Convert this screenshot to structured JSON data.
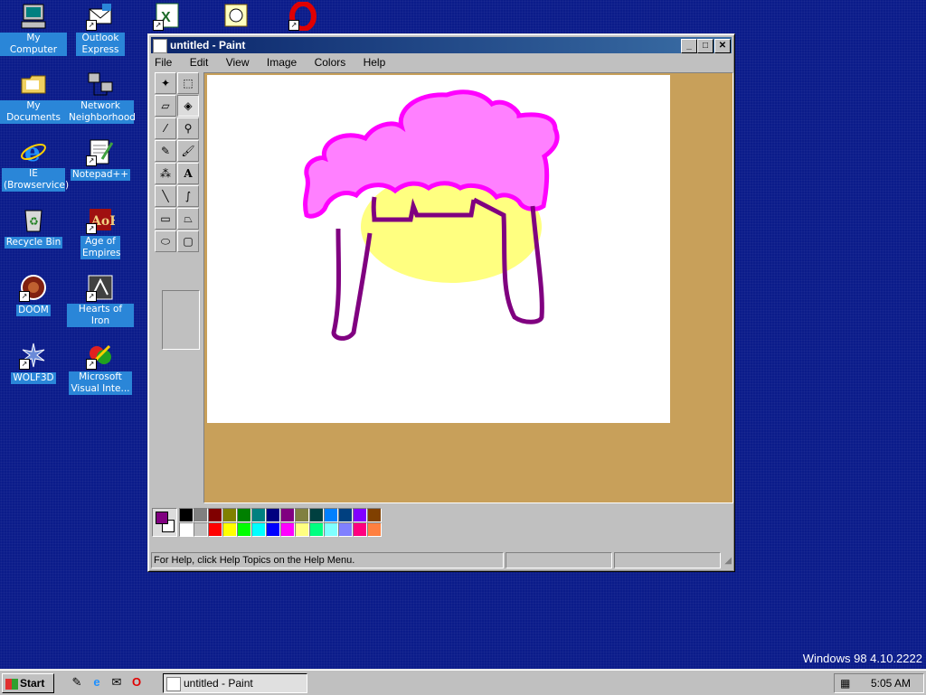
{
  "desktop": {
    "icons": [
      {
        "label": "My Computer"
      },
      {
        "label": "Outlook Express"
      },
      {
        "label": ""
      },
      {
        "label": ""
      },
      {
        "label": ""
      },
      {
        "label": "My Documents"
      },
      {
        "label": "Network Neighborhood"
      },
      {
        "label": "IE (Browservice)"
      },
      {
        "label": "Notepad++"
      },
      {
        "label": "Recycle Bin"
      },
      {
        "label": "Age of Empires"
      },
      {
        "label": "DOOM"
      },
      {
        "label": "Hearts of Iron"
      },
      {
        "label": "WOLF3D"
      },
      {
        "label": "Microsoft Visual Inte..."
      }
    ],
    "version_text": "Windows 98 4.10.2222"
  },
  "window": {
    "title": "untitled - Paint",
    "menu": [
      "File",
      "Edit",
      "View",
      "Image",
      "Colors",
      "Help"
    ],
    "tools": [
      "free-select",
      "rect-select",
      "eraser",
      "fill",
      "color-picker",
      "magnifier",
      "pencil",
      "brush",
      "airbrush",
      "text",
      "line",
      "curve",
      "rectangle",
      "polygon",
      "ellipse",
      "rounded-rect"
    ],
    "selected_tool": "fill",
    "status_text": "For Help, click Help Topics on the Help Menu.",
    "foreground_color": "#800080",
    "background_color": "#ffffff",
    "palette": [
      "#000000",
      "#808080",
      "#800000",
      "#808000",
      "#008000",
      "#008080",
      "#000080",
      "#800080",
      "#808040",
      "#004040",
      "#0080ff",
      "#004080",
      "#8000ff",
      "#804000",
      "#ffffff",
      "#c0c0c0",
      "#ff0000",
      "#ffff00",
      "#00ff00",
      "#00ffff",
      "#0000ff",
      "#ff00ff",
      "#ffff80",
      "#00ff80",
      "#80ffff",
      "#8080ff",
      "#ff0080",
      "#ff8040"
    ],
    "drawing_colors": {
      "hair": "#ff80ff",
      "hair_outline": "#ff00ff",
      "face": "#ffff80",
      "lines": "#800080"
    }
  },
  "taskbar": {
    "start_label": "Start",
    "task_label": "untitled - Paint",
    "clock": "5:05 AM"
  }
}
